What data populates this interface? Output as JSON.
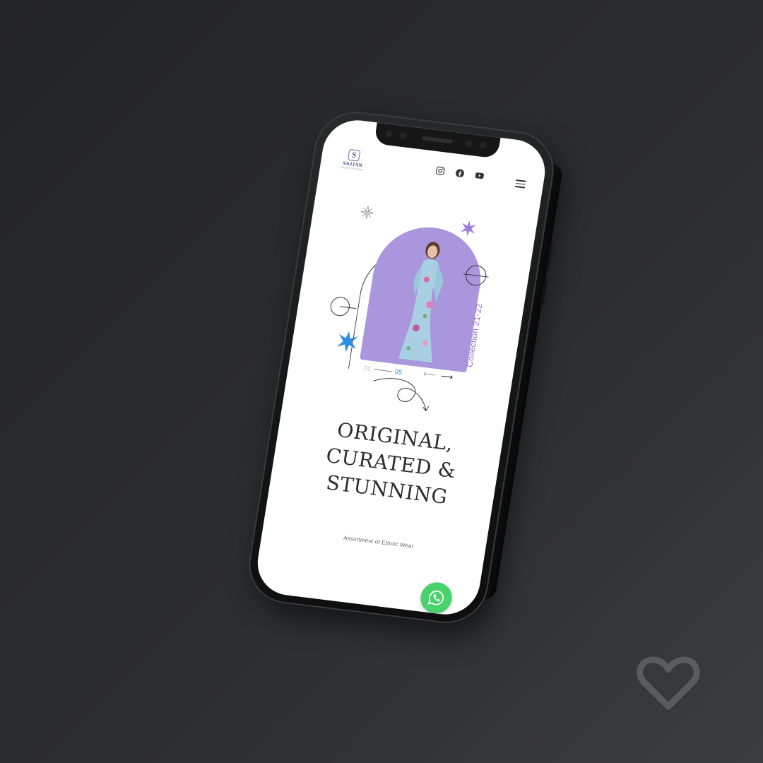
{
  "brand": {
    "name": "SAJJAN",
    "monogram": "S",
    "tagline": "THE ART OF ETHNIC"
  },
  "header": {
    "socials": [
      {
        "name": "instagram-icon",
        "label": ""
      },
      {
        "name": "facebook-icon",
        "label": ""
      },
      {
        "name": "youtube-icon",
        "label": ""
      }
    ],
    "menu_icon": "hamburger-menu-icon"
  },
  "hero": {
    "collection_label": "Collection 21-22",
    "slide_current": "01",
    "slide_total": "05",
    "prev_icon": "arrow-left-icon",
    "next_icon": "arrow-right-icon",
    "arch_color": "#a996dc"
  },
  "headline": {
    "line1": "ORIGINAL,",
    "line2": "CURATED &",
    "line3": "STUNNING"
  },
  "subtitle": "Assortment of Ethnic Wear",
  "whatsapp": {
    "icon": "whatsapp-icon",
    "color": "#48d26a"
  },
  "overlay": {
    "icon": "heart-icon"
  },
  "colors": {
    "accent": "#8c76cf",
    "pager": "#1d8fd8",
    "star_blue": "#2a8de3",
    "star_purple": "#9d7ae0"
  }
}
